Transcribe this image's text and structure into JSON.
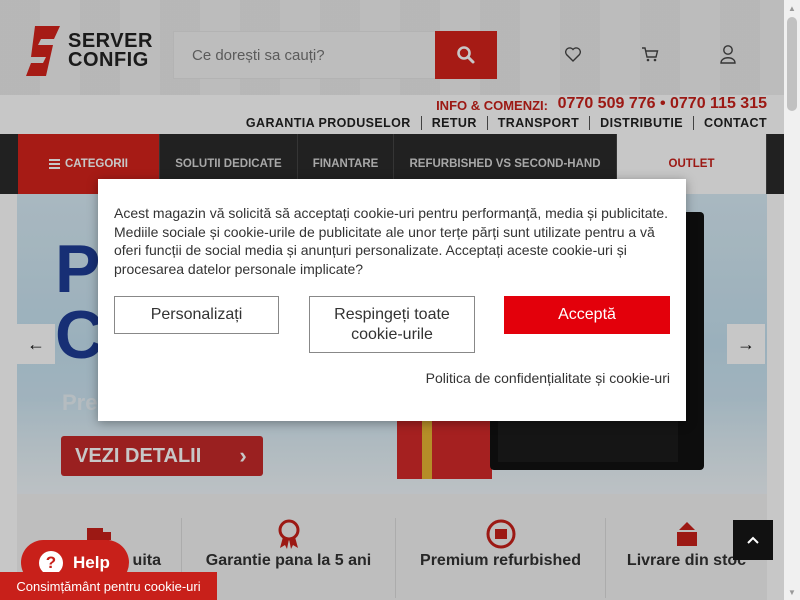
{
  "header": {
    "logo_line1": "SERVER",
    "logo_line2": "CONFIG",
    "search_placeholder": "Ce dorești sa cauți?",
    "icons": [
      "search-icon",
      "heart-icon",
      "cart-icon",
      "user-icon"
    ],
    "info_label": "INFO & COMENZI:",
    "phones": "0770 509 776 • 0770 115 315"
  },
  "top_links": [
    "GARANTIA PRODUSELOR",
    "RETUR",
    "TRANSPORT",
    "DISTRIBUTIE",
    "CONTACT"
  ],
  "nav": {
    "categories": "CATEGORII",
    "items": [
      "SOLUTII DEDICATE",
      "FINANTARE",
      "REFURBISHED VS SECOND-HAND"
    ],
    "outlet": "OUTLET"
  },
  "hero": {
    "big_line1": "P",
    "big_line2": "C",
    "sub": "Pre",
    "button": "VEZI DETALII"
  },
  "features": [
    "uita",
    "Garantie pana la 5 ani",
    "Premium refurbished",
    "Livrare din stoc"
  ],
  "help": {
    "label": "Help",
    "glyph": "?"
  },
  "consent_tab": "Consimțământ pentru cookie-uri",
  "cookie_dialog": {
    "text": "Acest magazin vă solicită să acceptați cookie-uri pentru performanță, media și publicitate. Mediile sociale și cookie-urile de publicitate ale unor terțe părți sunt utilizate pentru a vă oferi funcții de social media și anunțuri personalizate. Acceptați aceste cookie-uri și procesarea datelor personale implicate?",
    "customize": "Personalizați",
    "reject": "Respingeți toate cookie-urile",
    "accept": "Acceptă",
    "policy_link": "Politica de confidențialitate și cookie-uri"
  },
  "colors": {
    "brand_red": "#d5231c",
    "accept_red": "#e3000b",
    "nav_dark": "#2b2b2b",
    "hero_blue": "#1e3d96"
  }
}
